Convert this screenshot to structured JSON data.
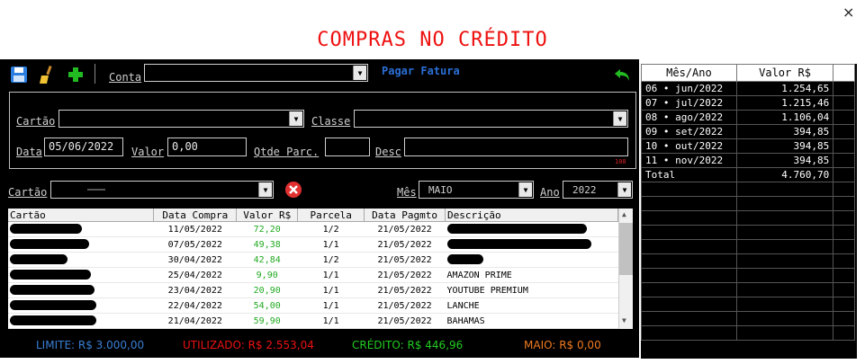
{
  "window": {
    "close": "×"
  },
  "title": "COMPRAS NO CRÉDITO",
  "toolbar": {
    "conta_label": "Conta",
    "conta_value": "",
    "pagar_fatura": "Pagar Fatura"
  },
  "form": {
    "cartao_label": "Cartão",
    "classe_label": "Classe",
    "data_label": "Data",
    "data_value": "05/06/2022",
    "valor_label": "Valor",
    "valor_value": "0,00",
    "qtde_label": "Qtde Parc.",
    "qtde_value": "",
    "desc_label": "Desc",
    "desc_value": "",
    "desc_counter": "100"
  },
  "filter": {
    "cartao_label": "Cartão",
    "mes_label": "Mês",
    "mes_value": "MAIO",
    "ano_label": "Ano",
    "ano_value": "2022"
  },
  "grid": {
    "headers": [
      "Cartão",
      "Data Compra",
      "Valor R$",
      "Parcela",
      "Data Pagmto",
      "Descrição"
    ],
    "rows": [
      {
        "cartao": "",
        "data": "11/05/2022",
        "valor": "72,20",
        "parcela": "1/2",
        "pagto": "21/05/2022",
        "desc": ""
      },
      {
        "cartao": "",
        "data": "07/05/2022",
        "valor": "49,38",
        "parcela": "1/1",
        "pagto": "21/05/2022",
        "desc": ""
      },
      {
        "cartao": "",
        "data": "30/04/2022",
        "valor": "42,84",
        "parcela": "1/2",
        "pagto": "21/05/2022",
        "desc": ""
      },
      {
        "cartao": "",
        "data": "25/04/2022",
        "valor": "9,90",
        "parcela": "1/1",
        "pagto": "21/05/2022",
        "desc": "AMAZON PRIME"
      },
      {
        "cartao": "",
        "data": "23/04/2022",
        "valor": "20,90",
        "parcela": "1/1",
        "pagto": "21/05/2022",
        "desc": "YOUTUBE PREMIUM"
      },
      {
        "cartao": "",
        "data": "22/04/2022",
        "valor": "54,00",
        "parcela": "1/1",
        "pagto": "21/05/2022",
        "desc": "LANCHE"
      },
      {
        "cartao": "",
        "data": "21/04/2022",
        "valor": "59,90",
        "parcela": "1/1",
        "pagto": "21/05/2022",
        "desc": "BAHAMAS"
      }
    ]
  },
  "status": {
    "limite": "LIMITE: R$ 3.000,00",
    "utilizado": "UTILIZADO: R$ 2.553,04",
    "credito": "CRÉDITO: R$ 446,96",
    "mes": "MAIO: R$ 0,00"
  },
  "summary": {
    "headers": [
      "Mês/Ano",
      "Valor R$"
    ],
    "rows": [
      {
        "mes": "06 • jun/2022",
        "valor": "1.254,65"
      },
      {
        "mes": "07 • jul/2022",
        "valor": "1.215,46"
      },
      {
        "mes": "08 • ago/2022",
        "valor": "1.106,04"
      },
      {
        "mes": "09 • set/2022",
        "valor": "394,85"
      },
      {
        "mes": "10 • out/2022",
        "valor": "394,85"
      },
      {
        "mes": "11 • nov/2022",
        "valor": "394,85"
      },
      {
        "mes": "Total",
        "valor": "4.760,70"
      }
    ]
  },
  "colors": {
    "title": "#ee1111",
    "limite": "#3a7fd4",
    "utilizado": "#ee1111",
    "credito": "#22cc22",
    "mes": "#f07a20",
    "pagar": "#2b6fd6"
  }
}
